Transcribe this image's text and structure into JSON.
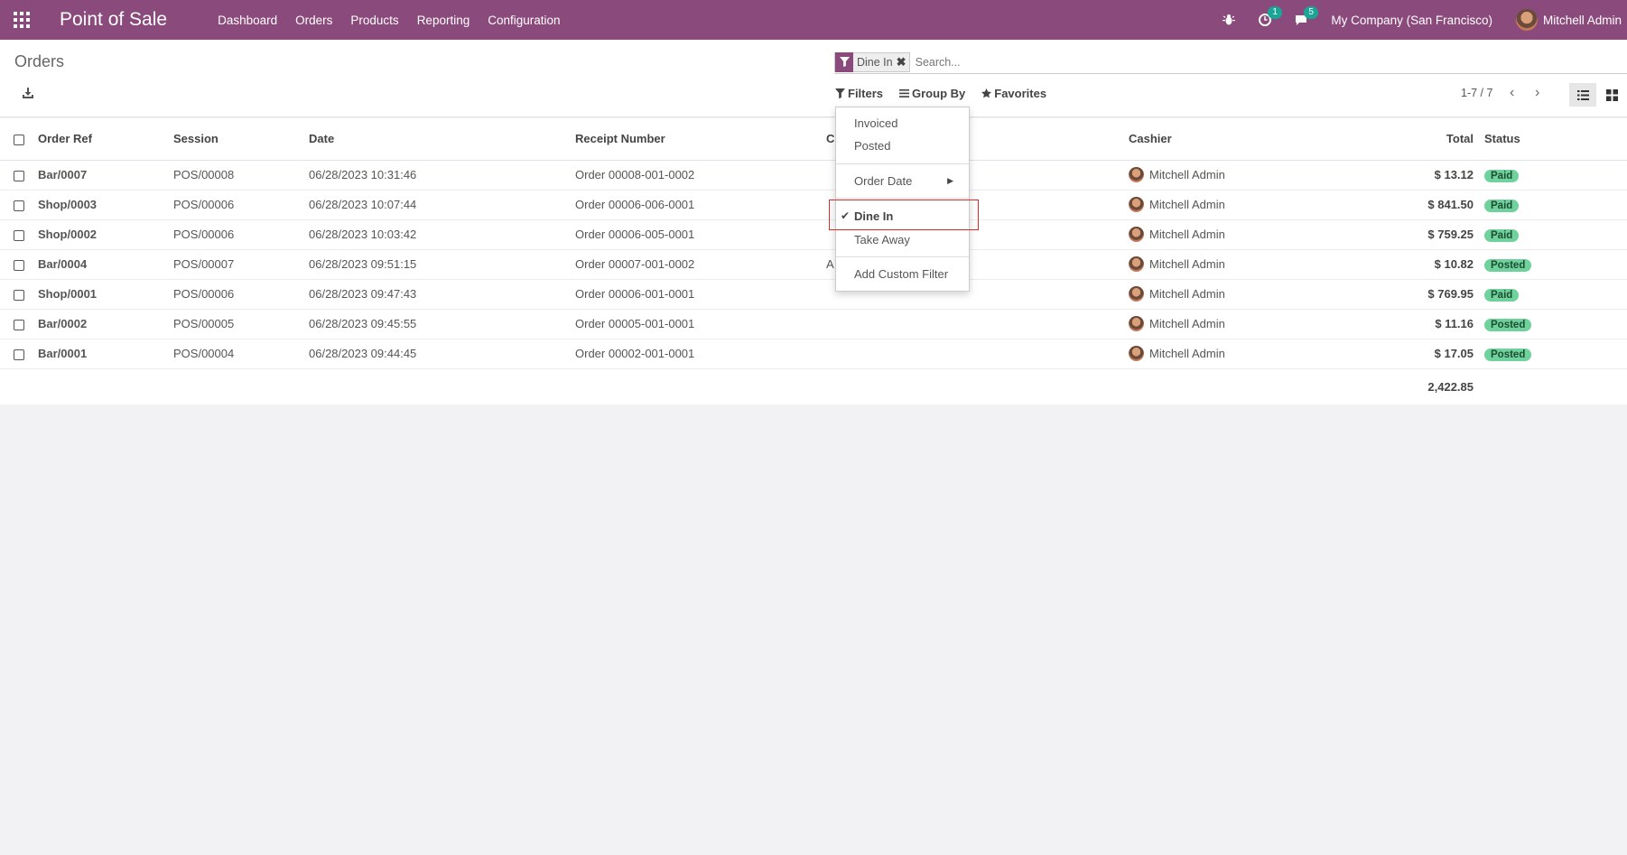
{
  "navbar": {
    "app_title": "Point of Sale",
    "menu": [
      "Dashboard",
      "Orders",
      "Products",
      "Reporting",
      "Configuration"
    ],
    "activity_badge": "1",
    "messages_badge": "5",
    "company": "My Company (San Francisco)",
    "user": "Mitchell Admin"
  },
  "control_panel": {
    "title": "Orders",
    "facet_label": "Dine In",
    "search_placeholder": "Search...",
    "filters_label": "Filters",
    "groupby_label": "Group By",
    "favorites_label": "Favorites",
    "pager": "1-7 / 7"
  },
  "filters_dropdown": {
    "items": [
      "Invoiced",
      "Posted",
      "Order Date",
      "Dine In",
      "Take Away",
      "Add Custom Filter"
    ],
    "selected": "Dine In"
  },
  "table": {
    "columns": [
      "Order Ref",
      "Session",
      "Date",
      "Receipt Number",
      "C",
      "Cashier",
      "Total",
      "Status"
    ],
    "rows": [
      {
        "ref": "Bar/0007",
        "session": "POS/00008",
        "date": "06/28/2023 10:31:46",
        "receipt": "Order 00008-001-0002",
        "customer": "",
        "cashier": "Mitchell Admin",
        "total": "$ 13.12",
        "status": "Paid"
      },
      {
        "ref": "Shop/0003",
        "session": "POS/00006",
        "date": "06/28/2023 10:07:44",
        "receipt": "Order 00006-006-0001",
        "customer": "",
        "cashier": "Mitchell Admin",
        "total": "$ 841.50",
        "status": "Paid"
      },
      {
        "ref": "Shop/0002",
        "session": "POS/00006",
        "date": "06/28/2023 10:03:42",
        "receipt": "Order 00006-005-0001",
        "customer": "",
        "cashier": "Mitchell Admin",
        "total": "$ 759.25",
        "status": "Paid"
      },
      {
        "ref": "Bar/0004",
        "session": "POS/00007",
        "date": "06/28/2023 09:51:15",
        "receipt": "Order 00007-001-0002",
        "customer": "A",
        "cashier": "Mitchell Admin",
        "total": "$ 10.82",
        "status": "Posted"
      },
      {
        "ref": "Shop/0001",
        "session": "POS/00006",
        "date": "06/28/2023 09:47:43",
        "receipt": "Order 00006-001-0001",
        "customer": "",
        "cashier": "Mitchell Admin",
        "total": "$ 769.95",
        "status": "Paid"
      },
      {
        "ref": "Bar/0002",
        "session": "POS/00005",
        "date": "06/28/2023 09:45:55",
        "receipt": "Order 00005-001-0001",
        "customer": "",
        "cashier": "Mitchell Admin",
        "total": "$ 11.16",
        "status": "Posted"
      },
      {
        "ref": "Bar/0001",
        "session": "POS/00004",
        "date": "06/28/2023 09:44:45",
        "receipt": "Order 00002-001-0001",
        "customer": "",
        "cashier": "Mitchell Admin",
        "total": "$ 17.05",
        "status": "Posted"
      }
    ],
    "sum_total": "2,422.85"
  },
  "colors": {
    "brand": "#8b4a7c",
    "badge_bg": "#6fd19b",
    "highlight": "#e02b2b"
  }
}
